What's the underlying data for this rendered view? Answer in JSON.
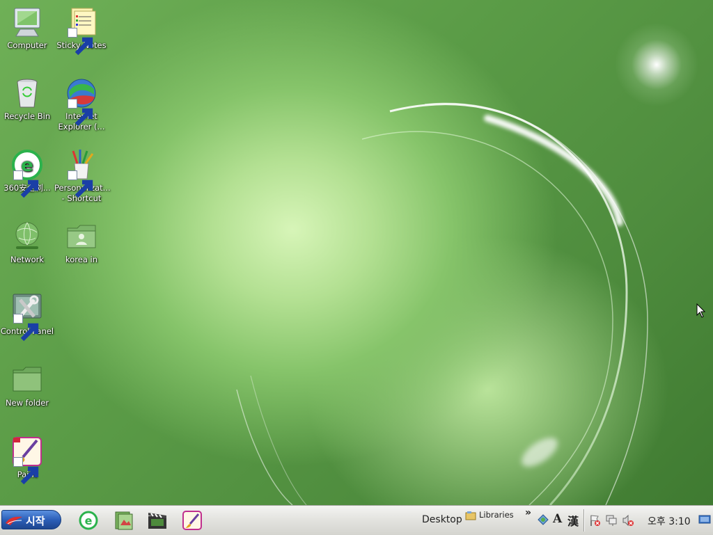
{
  "desktop": {
    "icons": [
      {
        "label": "Computer",
        "icon": "computer-icon"
      },
      {
        "label": "Sticky Notes",
        "icon": "sticky-notes-icon"
      },
      {
        "label": "Recycle Bin",
        "icon": "recycle-bin-icon"
      },
      {
        "label": "Internet Explorer (...",
        "icon": "internet-explorer-icon"
      },
      {
        "label": "360安全浏...",
        "icon": "browser-360-icon"
      },
      {
        "label": "Personalizat... - Shortcut",
        "icon": "personalization-icon"
      },
      {
        "label": "Network",
        "icon": "network-icon"
      },
      {
        "label": "korea in",
        "icon": "user-folder-icon"
      },
      {
        "label": "Control Panel",
        "icon": "control-panel-icon"
      },
      {
        "label": "New folder",
        "icon": "folder-icon"
      },
      {
        "label": "Paint",
        "icon": "paint-icon"
      }
    ]
  },
  "taskbar": {
    "start_label": "시작",
    "quick_launch": [
      "browser-icon",
      "photo-viewer-icon",
      "media-player-icon",
      "paint-icon"
    ],
    "desktop_toolbar": "Desktop",
    "libraries_toolbar": "Libraries",
    "overflow_chevron": "»",
    "ime_mode": "A",
    "ime_hanja": "漢",
    "clock": "오후 3:10"
  },
  "colors": {
    "start_blue": "#2c5fb8",
    "wallpaper_green": "#6fb057"
  }
}
